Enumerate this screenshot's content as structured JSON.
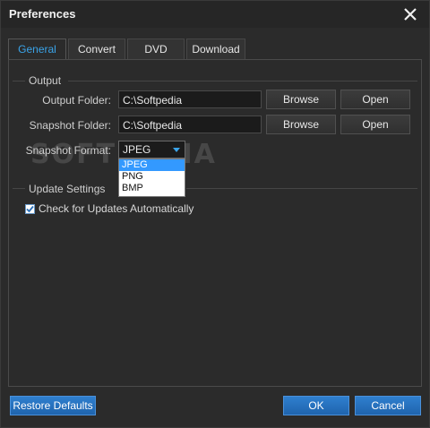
{
  "window": {
    "title": "Preferences"
  },
  "tabs": [
    {
      "label": "General",
      "active": true
    },
    {
      "label": "Convert",
      "active": false
    },
    {
      "label": "DVD",
      "active": false
    },
    {
      "label": "Download",
      "active": false
    }
  ],
  "output": {
    "section_title": "Output",
    "output_folder_label": "Output Folder:",
    "output_folder_value": "C:\\Softpedia",
    "snapshot_folder_label": "Snapshot Folder:",
    "snapshot_folder_value": "C:\\Softpedia",
    "snapshot_format_label": "Snapshot Format:",
    "snapshot_format_value": "JPEG",
    "format_options": [
      "JPEG",
      "PNG",
      "BMP"
    ],
    "browse_label": "Browse",
    "open_label": "Open"
  },
  "update": {
    "section_title": "Update Settings",
    "auto_check_label": "Check for Updates Automatically",
    "auto_check_checked": true
  },
  "footer": {
    "restore_label": "Restore Defaults",
    "ok_label": "OK",
    "cancel_label": "Cancel"
  },
  "watermark": "SOFTPEDIA",
  "colors": {
    "accent": "#3aa3e8",
    "primary_button": "#1f64ad"
  }
}
